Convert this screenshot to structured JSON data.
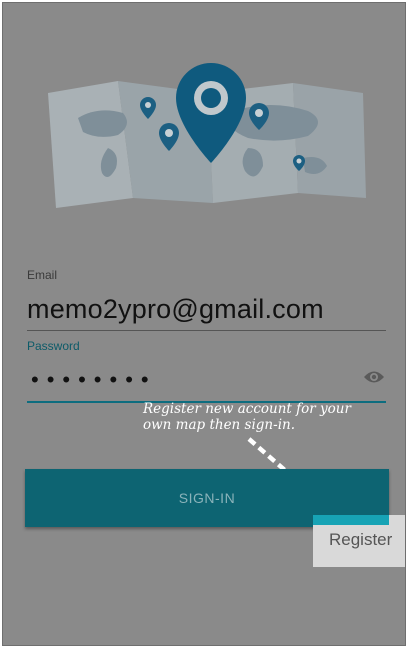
{
  "login": {
    "email_label": "Email",
    "email_value": "memo2ypro@gmail.com",
    "password_label": "Password",
    "password_masked": "••••••••",
    "signin_label": "SIGN-IN",
    "register_label": "Register"
  },
  "annotation": {
    "line1": "Register new account for your",
    "line2": "own map then sign-in."
  },
  "icons": {
    "map": "world-map-pin-icon",
    "eye": "eye-icon",
    "arrow": "dashed-arrow"
  },
  "colors": {
    "background": "#8a8a8a",
    "accent": "#0d6472",
    "annotation": "#ffffff",
    "register_highlight": "#d9d9d9"
  }
}
